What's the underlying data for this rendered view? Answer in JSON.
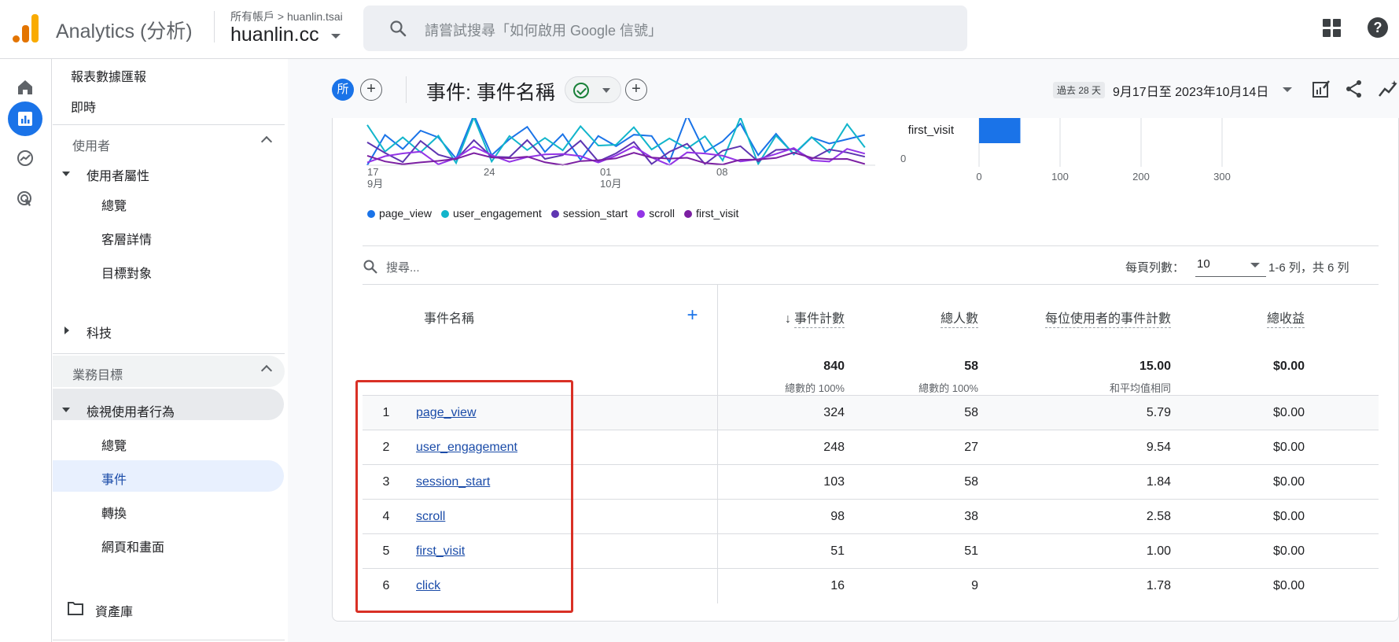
{
  "app": {
    "title": "Analytics (分析)",
    "breadcrumb": "所有帳戶 > huanlin.tsai",
    "account": "huanlin.cc",
    "search_placeholder": "請嘗試搜尋「如何啟用 Google 信號」",
    "help_glyph": "?"
  },
  "rail": [
    "home-icon",
    "reports-icon",
    "explore-icon",
    "advertising-icon"
  ],
  "nav": {
    "reports_snapshot": "報表數據匯報",
    "realtime": "即時",
    "users_section": "使用者",
    "user_attributes": "使用者屬性",
    "overview1": "總覽",
    "audience_details": "客層詳情",
    "audiences": "目標對象",
    "tech": "科技",
    "business_section": "業務目標",
    "engagement": "檢視使用者行為",
    "overview2": "總覽",
    "events": "事件",
    "conversions": "轉換",
    "pages_screens": "網頁和畫面",
    "library": "資產庫"
  },
  "report": {
    "badge": "所",
    "title": "事件: 事件名稱",
    "date_chip": "過去 28 天",
    "date_range": "9月17日至 2023年10月14日"
  },
  "chart_data": [
    {
      "type": "line",
      "x_ticks": [
        "17\n9月",
        "24",
        "01\n10月",
        "08"
      ],
      "y_tick_visible": "0",
      "series": [
        {
          "name": "page_view",
          "color": "#1a73e8"
        },
        {
          "name": "user_engagement",
          "color": "#12b5cb"
        },
        {
          "name": "session_start",
          "color": "#5e35b1"
        },
        {
          "name": "scroll",
          "color": "#9334e6"
        },
        {
          "name": "first_visit",
          "color": "#7b1fa2"
        }
      ]
    },
    {
      "type": "bar",
      "categories": [
        "first_visit"
      ],
      "values": [
        51
      ],
      "x_ticks": [
        "0",
        "100",
        "200",
        "300"
      ],
      "xlim": [
        0,
        330
      ]
    }
  ],
  "legend": [
    {
      "name": "page_view",
      "color": "#1a73e8"
    },
    {
      "name": "user_engagement",
      "color": "#12b5cb"
    },
    {
      "name": "session_start",
      "color": "#5e35b1"
    },
    {
      "name": "scroll",
      "color": "#9334e6"
    },
    {
      "name": "first_visit",
      "color": "#7b1fa2"
    }
  ],
  "table": {
    "search_placeholder": "搜尋...",
    "rows_per_page_label": "每頁列數：",
    "rows_per_page": "10",
    "pager": "1-6 列，共 6 列",
    "col_name": "事件名稱",
    "col_count": "事件計數",
    "col_users": "總人數",
    "col_per_user": "每位使用者的事件計數",
    "col_revenue": "總收益",
    "totals": {
      "count": "840",
      "count_sub": "總數的 100%",
      "users": "58",
      "users_sub": "總數的 100%",
      "per_user": "15.00",
      "per_user_sub": "和平均值相同",
      "revenue": "$0.00"
    },
    "rows": [
      {
        "idx": "1",
        "name": "page_view",
        "count": "324",
        "users": "58",
        "per_user": "5.79",
        "revenue": "$0.00"
      },
      {
        "idx": "2",
        "name": "user_engagement",
        "count": "248",
        "users": "27",
        "per_user": "9.54",
        "revenue": "$0.00"
      },
      {
        "idx": "3",
        "name": "session_start",
        "count": "103",
        "users": "58",
        "per_user": "1.84",
        "revenue": "$0.00"
      },
      {
        "idx": "4",
        "name": "scroll",
        "count": "98",
        "users": "38",
        "per_user": "2.58",
        "revenue": "$0.00"
      },
      {
        "idx": "5",
        "name": "first_visit",
        "count": "51",
        "users": "51",
        "per_user": "1.00",
        "revenue": "$0.00"
      },
      {
        "idx": "6",
        "name": "click",
        "count": "16",
        "users": "9",
        "per_user": "1.78",
        "revenue": "$0.00"
      }
    ]
  }
}
